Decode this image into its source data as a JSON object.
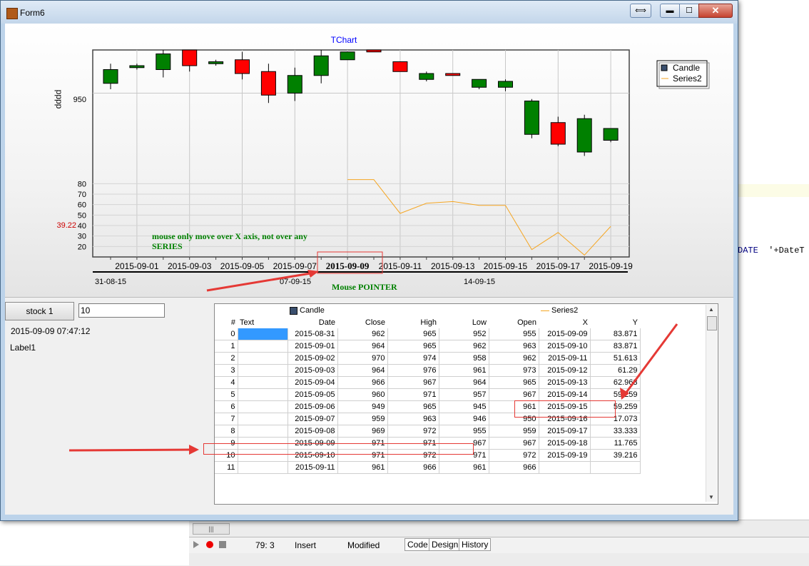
{
  "window": {
    "title": "Form6",
    "buttons": {
      "restore": "⟺",
      "minimize": "▬",
      "maximize": "☐",
      "close": "✕"
    }
  },
  "chart": {
    "title": "TChart",
    "left_axis_label": "pppp",
    "upper_tick": "950",
    "lower_ticks": [
      "80",
      "70",
      "60",
      "50",
      "40",
      "30",
      "20"
    ],
    "cursor_value": "39.22",
    "bottom_ticks": [
      "2015-09-01",
      "2015-09-03",
      "2015-09-05",
      "2015-09-07",
      "2015-09-09",
      "2015-09-11",
      "2015-09-13",
      "2015-09-15",
      "2015-09-17",
      "2015-09-19"
    ],
    "bold_tick": "2015-09-09",
    "secondary_axis_ticks": [
      "31-08-15",
      "07-09-15",
      "14-09-15"
    ],
    "annotation_note": "mouse only move over X axis, not over any SERIES",
    "annotation_pointer": "Mouse POINTER",
    "legend": [
      "Candle",
      "Series2"
    ],
    "colors": {
      "up": "#008000",
      "down": "#ff0000",
      "line": "#f5a623",
      "title": "#0000ff",
      "note": "#008000",
      "cursor": "#cc0000"
    }
  },
  "chart_data": [
    {
      "type": "candlestick",
      "title": "TChart",
      "ylabel": "pppp",
      "name": "Candle",
      "ylim": [
        920,
        972
      ],
      "candles": [
        {
          "date": "2015-08-31",
          "open": 955,
          "high": 965,
          "low": 952,
          "close": 962
        },
        {
          "date": "2015-09-01",
          "open": 963,
          "high": 965,
          "low": 962,
          "close": 964
        },
        {
          "date": "2015-09-02",
          "open": 962,
          "high": 974,
          "low": 958,
          "close": 970
        },
        {
          "date": "2015-09-03",
          "open": 973,
          "high": 976,
          "low": 961,
          "close": 964
        },
        {
          "date": "2015-09-04",
          "open": 965,
          "high": 967,
          "low": 964,
          "close": 966
        },
        {
          "date": "2015-09-05",
          "open": 967,
          "high": 971,
          "low": 957,
          "close": 960
        },
        {
          "date": "2015-09-06",
          "open": 961,
          "high": 965,
          "low": 945,
          "close": 949
        },
        {
          "date": "2015-09-07",
          "open": 950,
          "high": 963,
          "low": 946,
          "close": 959
        },
        {
          "date": "2015-09-08",
          "open": 959,
          "high": 972,
          "low": 955,
          "close": 969
        },
        {
          "date": "2015-09-09",
          "open": 967,
          "high": 971,
          "low": 967,
          "close": 971
        },
        {
          "date": "2015-09-10",
          "open": 972,
          "high": 972,
          "low": 971,
          "close": 971
        },
        {
          "date": "2015-09-11",
          "open": 966,
          "high": 966,
          "low": 961,
          "close": 961
        },
        {
          "date": "2015-09-12",
          "open": 957,
          "high": 961,
          "low": 956,
          "close": 960
        },
        {
          "date": "2015-09-13",
          "open": 960,
          "high": 960,
          "low": 959,
          "close": 959
        },
        {
          "date": "2015-09-14",
          "open": 953,
          "high": 957,
          "low": 952,
          "close": 957
        },
        {
          "date": "2015-09-15",
          "open": 953,
          "high": 957,
          "low": 951,
          "close": 956
        },
        {
          "date": "2015-09-16",
          "open": 929,
          "high": 947,
          "low": 927,
          "close": 946
        },
        {
          "date": "2015-09-17",
          "open": 935,
          "high": 938,
          "low": 923,
          "close": 924
        },
        {
          "date": "2015-09-18",
          "open": 920,
          "high": 939,
          "low": 918,
          "close": 937
        },
        {
          "date": "2015-09-19",
          "open": 926,
          "high": 932,
          "low": 925,
          "close": 932
        }
      ]
    },
    {
      "type": "line",
      "name": "Series2",
      "ylim": [
        10,
        85
      ],
      "x": [
        "2015-09-09",
        "2015-09-10",
        "2015-09-11",
        "2015-09-12",
        "2015-09-13",
        "2015-09-14",
        "2015-09-15",
        "2015-09-16",
        "2015-09-17",
        "2015-09-18",
        "2015-09-19"
      ],
      "y": [
        83.871,
        83.871,
        51.613,
        61.29,
        62.963,
        59.259,
        59.259,
        17.073,
        33.333,
        11.765,
        39.216
      ]
    }
  ],
  "controls": {
    "stock_button": "stock 1",
    "edit_value": "10",
    "datetime_label": "2015-09-09 07:47:12",
    "label1": "Label1"
  },
  "grid": {
    "legend_candle": "Candle",
    "legend_series2": "Series2",
    "headers": [
      "#",
      "Text",
      "Date",
      "Close",
      "High",
      "Low",
      "Open",
      "X",
      "Y"
    ],
    "rows": [
      [
        "0",
        "",
        "2015-08-31",
        "962",
        "965",
        "952",
        "955",
        "2015-09-09",
        "83.871"
      ],
      [
        "1",
        "",
        "2015-09-01",
        "964",
        "965",
        "962",
        "963",
        "2015-09-10",
        "83.871"
      ],
      [
        "2",
        "",
        "2015-09-02",
        "970",
        "974",
        "958",
        "962",
        "2015-09-11",
        "51.613"
      ],
      [
        "3",
        "",
        "2015-09-03",
        "964",
        "976",
        "961",
        "973",
        "2015-09-12",
        "61.29"
      ],
      [
        "4",
        "",
        "2015-09-04",
        "966",
        "967",
        "964",
        "965",
        "2015-09-13",
        "62.963"
      ],
      [
        "5",
        "",
        "2015-09-05",
        "960",
        "971",
        "957",
        "967",
        "2015-09-14",
        "59.259"
      ],
      [
        "6",
        "",
        "2015-09-06",
        "949",
        "965",
        "945",
        "961",
        "2015-09-15",
        "59.259"
      ],
      [
        "7",
        "",
        "2015-09-07",
        "959",
        "963",
        "946",
        "950",
        "2015-09-16",
        "17.073"
      ],
      [
        "8",
        "",
        "2015-09-08",
        "969",
        "972",
        "955",
        "959",
        "2015-09-17",
        "33.333"
      ],
      [
        "9",
        "",
        "2015-09-09",
        "971",
        "971",
        "967",
        "967",
        "2015-09-18",
        "11.765"
      ],
      [
        "10",
        "",
        "2015-09-10",
        "971",
        "972",
        "971",
        "972",
        "2015-09-19",
        "39.216"
      ],
      [
        "11",
        "",
        "2015-09-11",
        "961",
        "966",
        "961",
        "966",
        "",
        ""
      ]
    ]
  },
  "ide": {
    "code_fragment_kw": "DATE",
    "code_fragment_rest": "'+DateT",
    "status_position": "79:  3",
    "status_mode": "Insert",
    "status_modified": "Modified",
    "tabs": [
      "Code",
      "Design",
      "History"
    ],
    "scrollbar_grip": "|||"
  }
}
